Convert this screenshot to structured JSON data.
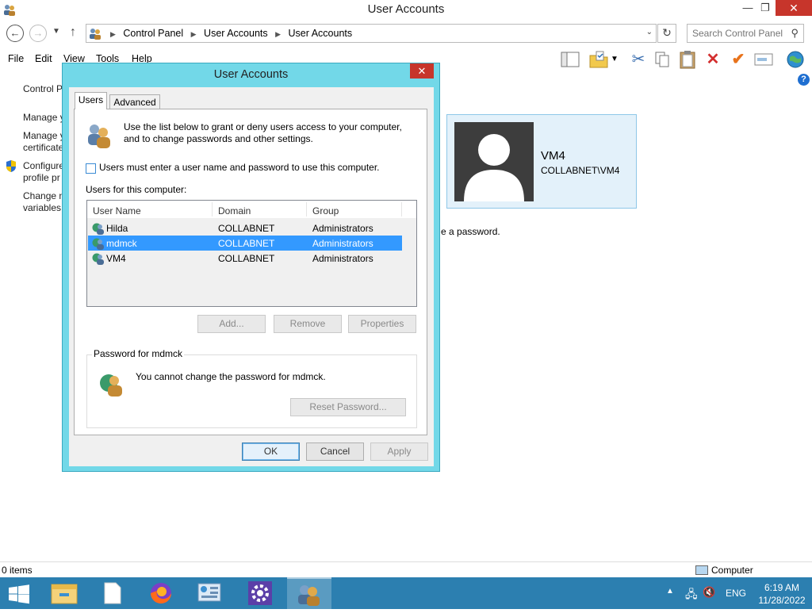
{
  "window": {
    "title": "User Accounts",
    "controls": {
      "minimize": "—",
      "maximize": "❐",
      "close": "✕"
    }
  },
  "address": {
    "crumbs": [
      "Control Panel",
      "User Accounts",
      "User Accounts"
    ],
    "search_placeholder": "Search Control Panel"
  },
  "menu": [
    "File",
    "Edit",
    "View",
    "Tools",
    "Help"
  ],
  "sidebar": {
    "items": [
      "Control P",
      "Manage y",
      "Manage y\ncertificate",
      "Configure\nprofile pr",
      "Change n\nvariables"
    ]
  },
  "user_card": {
    "name": "VM4",
    "domain": "COLLABNET\\VM4"
  },
  "background_text": "e a password.",
  "status": {
    "items": "0 items",
    "location": "Computer"
  },
  "dialog": {
    "title": "User Accounts",
    "tabs": [
      "Users",
      "Advanced"
    ],
    "intro": "Use the list below to grant or deny users access to your computer, and to change passwords and other settings.",
    "checkbox_label": "Users must enter a user name and password to use this computer.",
    "checkbox_checked": false,
    "list_label": "Users for this computer:",
    "columns": [
      "User Name",
      "Domain",
      "Group"
    ],
    "users": [
      {
        "name": "Hilda",
        "domain": "COLLABNET",
        "group": "Administrators"
      },
      {
        "name": "mdmck",
        "domain": "COLLABNET",
        "group": "Administrators",
        "selected": true
      },
      {
        "name": "VM4",
        "domain": "COLLABNET",
        "group": "Administrators"
      }
    ],
    "buttons": {
      "add": "Add...",
      "remove": "Remove",
      "properties": "Properties"
    },
    "password_group": "Password for mdmck",
    "password_text": "You cannot change the password for mdmck.",
    "reset_button": "Reset Password...",
    "ok": "OK",
    "cancel": "Cancel",
    "apply": "Apply"
  },
  "taskbar": {
    "apps": [
      "start",
      "file-explorer",
      "documents",
      "firefox",
      "control-panel",
      "settings",
      "user-accounts"
    ],
    "language": "ENG",
    "time": "6:19 AM",
    "date": "11/28/2022"
  },
  "colors": {
    "dialog_frame": "#72d8e8",
    "selection": "#3399ff",
    "taskbar": "#2c7fb0",
    "close": "#c7352b"
  }
}
